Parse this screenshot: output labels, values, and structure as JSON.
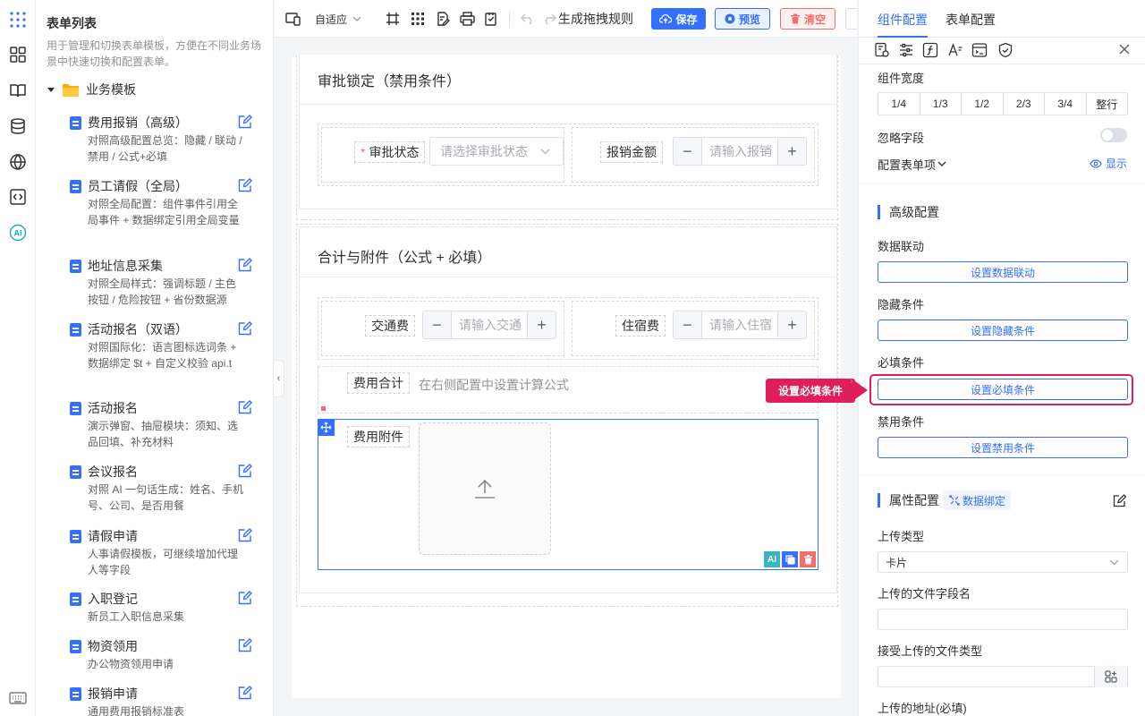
{
  "sidebar": {
    "title": "表单列表",
    "description": "用于管理和切换表单模板，方便在不同业务场景中快速切换和配置表单。",
    "folder": "业务模板",
    "templates": [
      {
        "name": "费用报销（高级）",
        "desc": "对照高级配置总览：隐藏 / 联动 / 禁用 / 公式+必填"
      },
      {
        "name": "员工请假（全局）",
        "desc": "对照全局配置：组件事件引用全局事件 + 数据绑定引用全局变量"
      },
      {
        "name": "地址信息采集",
        "desc": "对照全局样式：强调标题 / 主色按钮 / 危险按钮 + 省份数据源"
      },
      {
        "name": "活动报名（双语）",
        "desc": "对照国际化：语言图标选词条 + 数据绑定 $t + 自定义校验 api.t"
      },
      {
        "name": "活动报名",
        "desc": "演示弹窗、抽屉模块：须知、选品回填、补充材料"
      },
      {
        "name": "会议报名",
        "desc": "对照 AI 一句话生成：姓名、手机号、公司、是否用餐"
      },
      {
        "name": "请假申请",
        "desc": "人事请假模板，可继续增加代理人等字段"
      },
      {
        "name": "入职登记",
        "desc": "新员工入职信息采集"
      },
      {
        "name": "物资领用",
        "desc": "办公物资领用申请"
      },
      {
        "name": "报销申请",
        "desc": "通用费用报销标准表"
      }
    ]
  },
  "toolbar": {
    "mode": "自适应",
    "rules": "生成拖拽规则",
    "save": "保存",
    "preview": "预览",
    "clear": "清空"
  },
  "canvas": {
    "section1": {
      "title": "审批锁定（禁用条件）",
      "field1_label": "审批状态",
      "field1_placeholder": "请选择审批状态",
      "field2_label": "报销金额",
      "field2_placeholder": "请输入报销"
    },
    "section2": {
      "title": "合计与附件（公式 + 必填）",
      "field1_label": "交通费",
      "field1_placeholder": "请输入交通",
      "field2_label": "住宿费",
      "field2_placeholder": "请输入住宿",
      "total_label": "费用合计",
      "total_text": "在右侧配置中设置计算公式",
      "attach_label": "费用附件",
      "ai_badge": "AI"
    }
  },
  "panel": {
    "tab_component": "组件配置",
    "tab_form": "表单配置",
    "width_label": "组件宽度",
    "widths": [
      "1/4",
      "1/3",
      "1/2",
      "2/3",
      "3/4",
      "整行"
    ],
    "ignore_label": "忽略字段",
    "config_items_label": "配置表单项",
    "show_label": "显示",
    "advanced_title": "高级配置",
    "linkage_label": "数据联动",
    "linkage_btn": "设置数据联动",
    "hidden_label": "隐藏条件",
    "hidden_btn": "设置隐藏条件",
    "required_label": "必填条件",
    "required_btn": "设置必填条件",
    "disabled_label": "禁用条件",
    "disabled_btn": "设置禁用条件",
    "props_title": "属性配置",
    "binding_tag": "数据绑定",
    "upload_type_label": "上传类型",
    "upload_type_value": "卡片",
    "field_name_label": "上传的文件字段名",
    "accept_label": "接受上传的文件类型",
    "action_label": "上传的地址(必填)"
  },
  "callout": "设置必填条件",
  "colors": {
    "primary": "#3370ff",
    "danger": "#f56c6c",
    "callout": "#e01e5a"
  }
}
